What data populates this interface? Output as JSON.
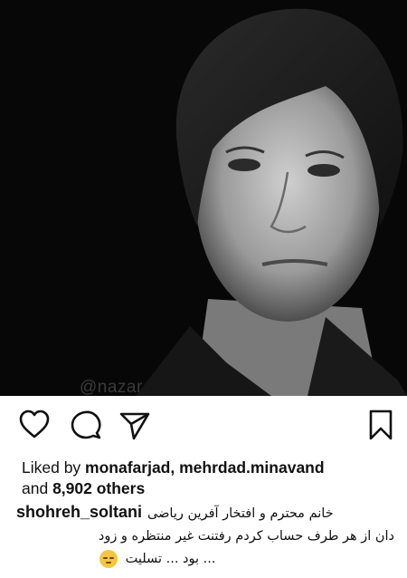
{
  "photo": {
    "watermark": "@nazar",
    "description_icon": "portrait-photo"
  },
  "actions": {
    "like_icon": "heart-icon",
    "comment_icon": "comment-icon",
    "share_icon": "send-icon",
    "save_icon": "bookmark-icon"
  },
  "likes": {
    "prefix": "Liked by ",
    "user1": "monafarjad",
    "separator": ", ",
    "user2": "mehrdad.minavand",
    "and": "and ",
    "others": "8,902 others"
  },
  "caption": {
    "username": "shohreh_soltani",
    "line1": "خانم محترم و افتخار آفرین ریاضی",
    "line2": "دان  از هر طرف حساب کردم رفتنت غیر منتظره و زود",
    "line3": "... بود ... تسلیت",
    "emoji": "pensive-face"
  }
}
